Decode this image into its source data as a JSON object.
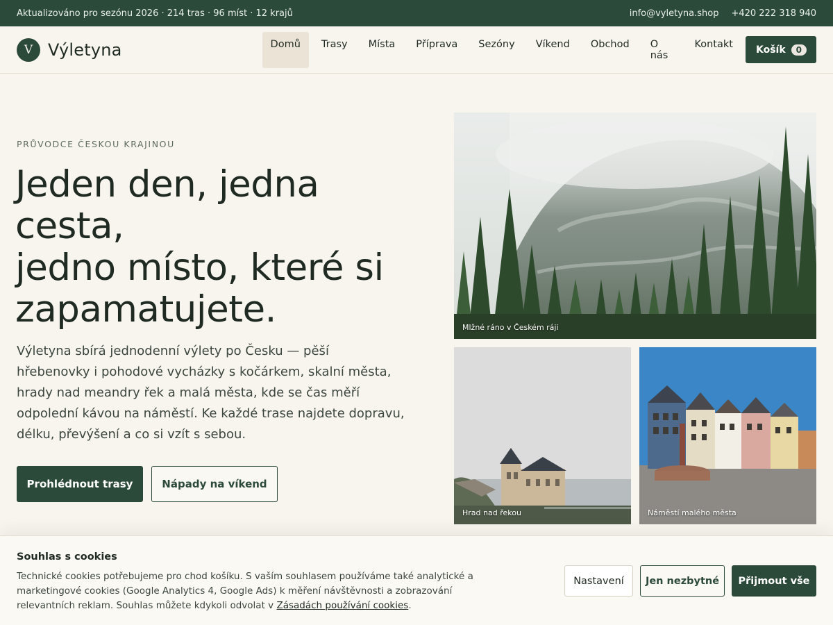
{
  "topbar": {
    "meta": "Aktualizováno pro sezónu 2026 · 214 tras · 96 míst · 12 krajů",
    "email": "info@vyletyna.shop",
    "phone": "+420 222 318 940"
  },
  "brand": {
    "logo_letter": "V",
    "name": "Výletyna"
  },
  "nav": {
    "items": [
      {
        "label": "Domů",
        "active": true
      },
      {
        "label": "Trasy"
      },
      {
        "label": "Místa"
      },
      {
        "label": "Příprava"
      },
      {
        "label": "Sezóny"
      },
      {
        "label": "Víkend"
      },
      {
        "label": "Obchod"
      },
      {
        "label": "O nás"
      },
      {
        "label": "Kontakt"
      }
    ],
    "cart_label": "Košík",
    "cart_count": "0"
  },
  "hero": {
    "eyebrow": "PRŮVODCE ČESKOU KRAJINOU",
    "headline_line1": "Jeden den, jedna",
    "headline_line2": "cesta,",
    "headline_line3": "jedno místo, které si",
    "headline_line4": "zapamatujete.",
    "lead": "Výletyna sbírá jednodenní výlety po Česku — pěší hřebenovky i pohodové vycházky s kočárkem, skalní města, hrady nad meandry řek a malá města, kde se čas měří odpolední kávou na náměstí. Ke každé trase najdete dopravu, délku, převýšení a co si vzít s sebou.",
    "primary_button": "Prohlédnout trasy",
    "secondary_button": "Nápady na víkend"
  },
  "photos": {
    "main_caption": "Mlžné ráno v Českém ráji",
    "castle_caption": "Hrad nad řekou",
    "town_caption": "Náměstí malého města"
  },
  "cookie": {
    "title": "Souhlas s cookies",
    "text": "Technické cookies potřebujeme pro chod košíku. S vaším souhlasem používáme také analytické a marketingové cookies (Google Analytics 4, Google Ads) k měření návštěvnosti a zobrazování relevantních reklam. Souhlas můžete kdykoli odvolat v ",
    "link": "Zásadách používání cookies",
    "text_end": ".",
    "settings_button": "Nastavení",
    "necessary_button": "Jen nezbytné",
    "accept_button": "Přijmout vše"
  }
}
